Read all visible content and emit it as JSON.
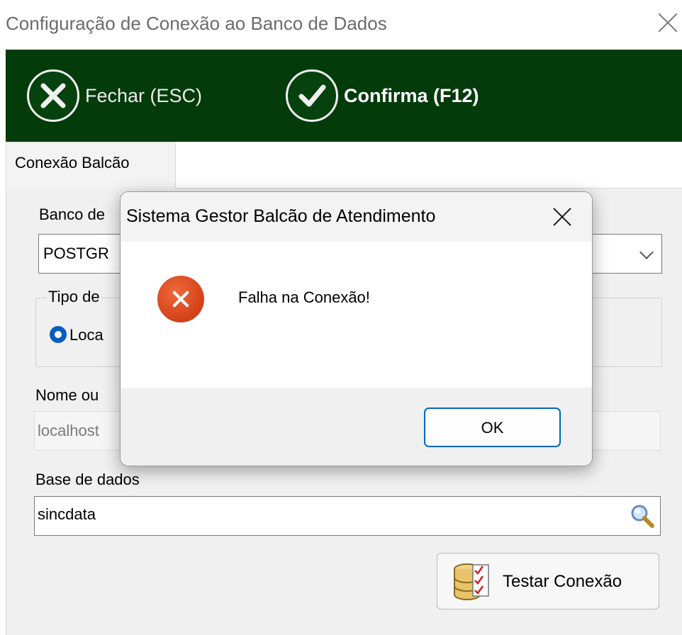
{
  "window": {
    "title": "Configuração de Conexão  ao Banco de Dados"
  },
  "toolbar": {
    "close_label": "Fechar (ESC)",
    "confirm_label": "Confirma (F12)",
    "background_color": "#043b0a"
  },
  "tabs": [
    {
      "label": "Conexão Balcão",
      "selected": true
    }
  ],
  "form": {
    "db_label": "Banco de",
    "db_value": "POSTGR",
    "conn_type_label": "Tipo de",
    "radio_label": "Loca",
    "host_label": "Nome ou",
    "host_value": "localhost",
    "database_label": "Base de dados",
    "database_value": "sincdata",
    "test_button_label": "Testar Conexão"
  },
  "dialog": {
    "title": "Sistema Gestor Balcão de Atendimento",
    "message": "Falha na Conexão!",
    "ok_label": "OK",
    "icon": "error-icon",
    "accent_color": "#0067c0"
  }
}
